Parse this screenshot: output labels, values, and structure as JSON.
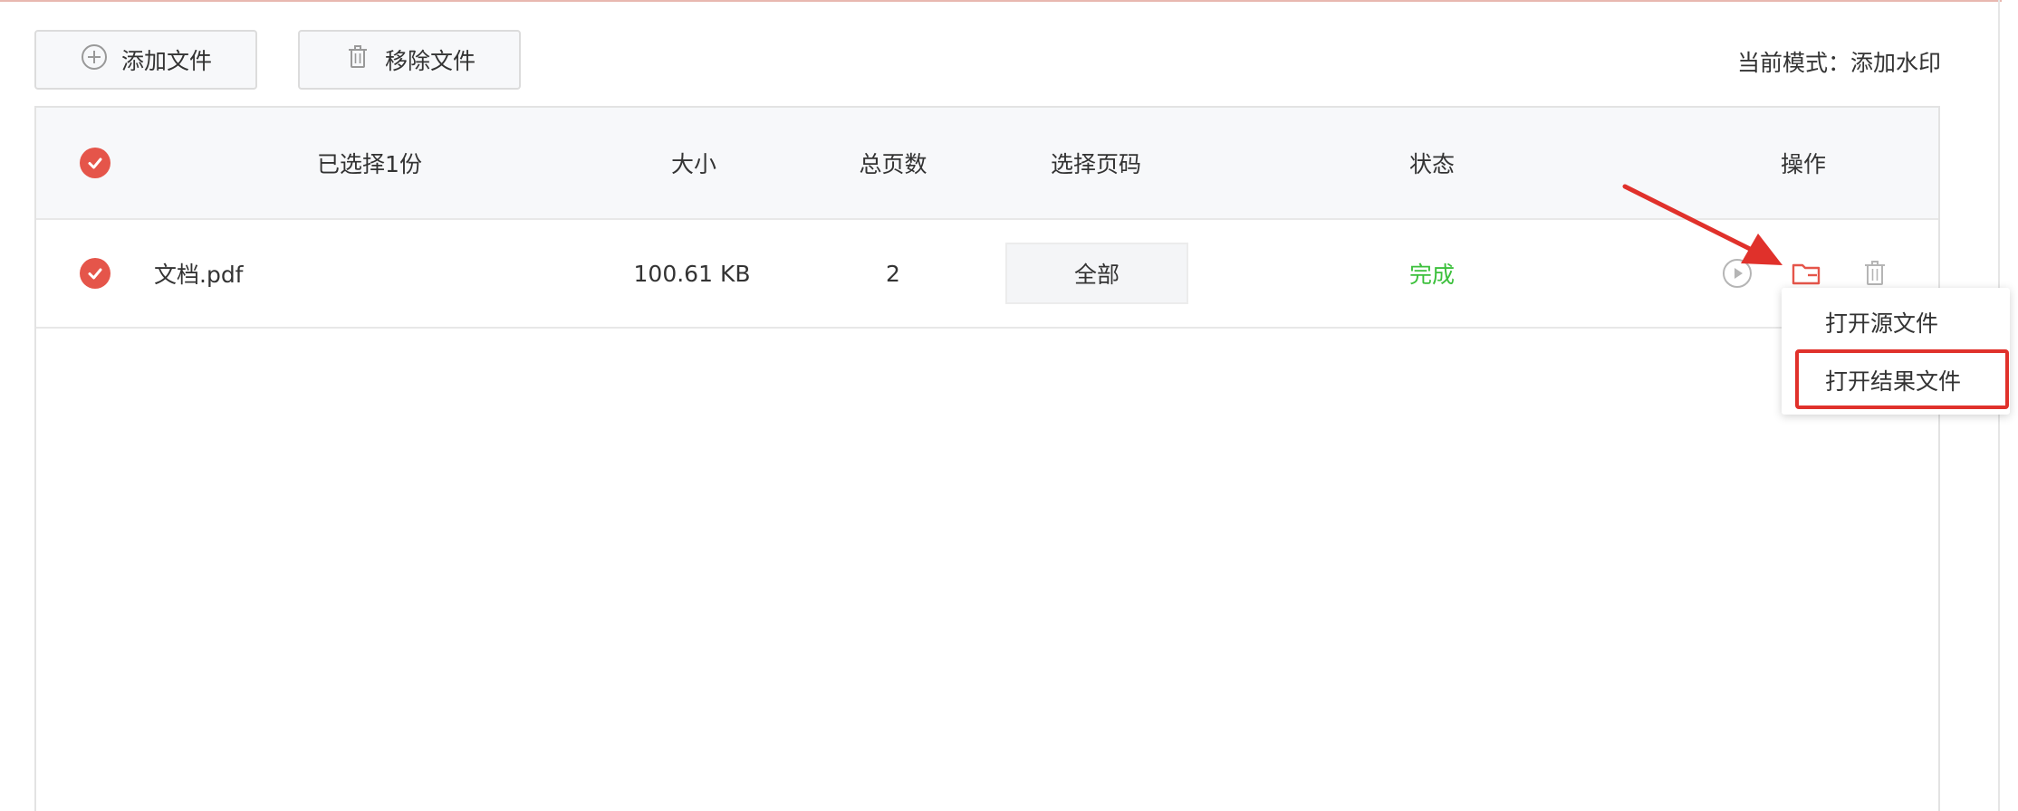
{
  "toolbar": {
    "add_label": "添加文件",
    "remove_label": "移除文件"
  },
  "mode": {
    "text": "当前模式：添加水印"
  },
  "table": {
    "columns": {
      "selected": "已选择1份",
      "size": "大小",
      "pages": "总页数",
      "page_select": "选择页码",
      "status": "状态",
      "actions": "操作"
    },
    "rows": [
      {
        "name": "文档.pdf",
        "size": "100.61 KB",
        "pages": "2",
        "page_select": "全部",
        "status": "完成"
      }
    ]
  },
  "dropdown": {
    "items": [
      "打开源文件",
      "打开结果文件"
    ]
  },
  "colors": {
    "accent": "#e5554a",
    "status_done": "#3cc03c",
    "highlight": "#e0312b",
    "header_bg": "#f7f8fa"
  },
  "icons": [
    "plus-circle-icon",
    "trash-icon",
    "check-circle-icon",
    "play-circle-icon",
    "folder-icon",
    "red-arrow-annotation"
  ]
}
